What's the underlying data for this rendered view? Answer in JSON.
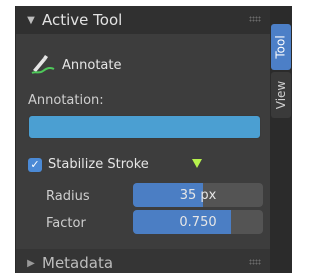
{
  "panel": {
    "active_tool_header": "Active Tool",
    "tool_name": "Annotate",
    "annotation_label": "Annotation:",
    "annotation_color": "#4b9fd2",
    "stabilize_label": "Stabilize Stroke",
    "stabilize_checked": true,
    "radius_label": "Radius",
    "radius_value": "35 px",
    "radius_fill_fraction": 0.54,
    "factor_label": "Factor",
    "factor_value": "0.750",
    "factor_fill_fraction": 0.75,
    "metadata_header": "Metadata"
  },
  "tabs": {
    "tool": "Tool",
    "view": "View"
  },
  "icons": {
    "collapse_open": "triangle-down-icon",
    "collapse_closed": "triangle-right-icon",
    "annotate": "annotate-pen-icon",
    "stabilize_arrow": "down-arrow-icon"
  },
  "colors": {
    "accent": "#4b8ad6",
    "panel_bg": "#3d3d3d",
    "stabilize_arrow": "#b6f24d"
  }
}
